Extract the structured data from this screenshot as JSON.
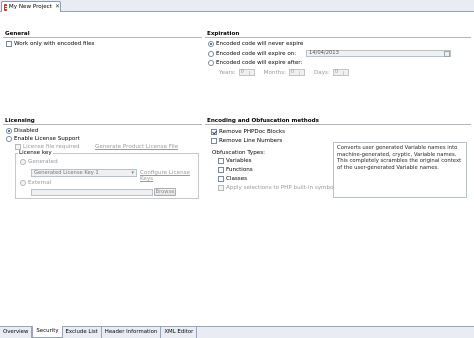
{
  "editor_tab": {
    "title": "My New Project",
    "close": "✕"
  },
  "general": {
    "title": "General",
    "work_only_encoded": "Work only with encoded files"
  },
  "expiration": {
    "title": "Expiration",
    "never_expire": "Encoded code will never expire",
    "expire_on": "Encoded code will expire on:",
    "expire_on_date": "14/04/2013",
    "expire_after": "Encoded code will expire after:",
    "years_label": "Years:",
    "years_value": "0",
    "months_label": "Months:",
    "months_value": "0",
    "days_label": "Days:",
    "days_value": "0"
  },
  "licensing": {
    "title": "Licensing",
    "disabled": "Disabled",
    "enable_support": "Enable License Support",
    "license_required": "License file required",
    "generate_link": "Generate Product License File",
    "license_key_label": "License key",
    "generated": "Generated",
    "generated_key": "Generated License Key 1",
    "configure_link": "Configure License Keys",
    "external": "External",
    "browse": "Browse"
  },
  "encoding": {
    "title": "Encoding and Obfuscation methods",
    "remove_phpdoc": "Remove PHPDoc Blocks",
    "remove_line_numbers": "Remove Line Numbers",
    "obfuscation_types": "Obfuscation Types:",
    "variables": "Variables",
    "functions": "Functions",
    "classes": "Classes",
    "apply_builtin": "Apply selections to PHP built-in symbols",
    "description": "Converts user generated Variable names into machine-generated, cryptic, Variable names. This completely scrambles the original context of the user-generated Variable names."
  },
  "bottom_tabs": [
    {
      "label": "Overview"
    },
    {
      "label": "Security"
    },
    {
      "label": "Exclude List"
    },
    {
      "label": "Header Information"
    },
    {
      "label": "XML Editor"
    }
  ],
  "colors": {
    "accent": "#1b4d8a",
    "tab_bg": "#e9edf3",
    "border": "#98a5b8"
  }
}
